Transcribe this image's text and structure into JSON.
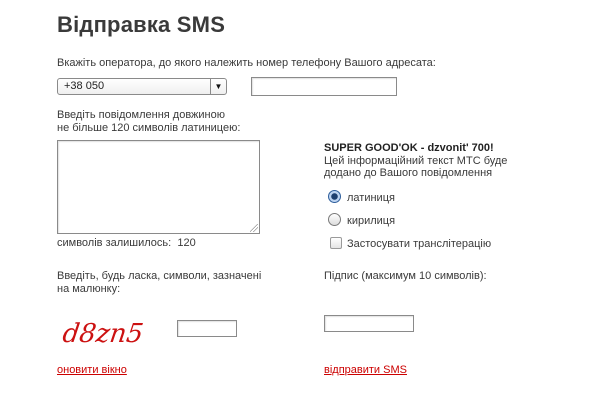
{
  "page_title": "Відправка SMS",
  "operator": {
    "label": "Вкажіть оператора, до якого належить номер телефону Вашого адресата:",
    "selected": "+38 050",
    "arrow": "▼",
    "phone_value": ""
  },
  "message": {
    "label_line1": "Введіть повідомлення довжиною",
    "label_line2": "не більше 120  символів латиницею:",
    "value": "",
    "remaining_label": "символів залишилось:",
    "remaining_count": "120"
  },
  "promo": {
    "title": "SUPER GOOD'OK - dzvonit' 700!",
    "line1": "Цей інформаційний текст МТС буде",
    "line2": "додано до Вашого повідомлення"
  },
  "encoding": {
    "options": [
      {
        "label": "латиниця",
        "selected": true
      },
      {
        "label": "кирилиця",
        "selected": false
      }
    ],
    "transliteration_label": "Застосувати транслітерацію",
    "transliteration_checked": false
  },
  "captcha": {
    "label_line1": "Введіть, будь ласка, символи, зазначені",
    "label_line2": "на малюнку:",
    "image_text": "d8zn5",
    "value": "",
    "refresh_link": "оновити вікно"
  },
  "signature": {
    "label": "Підпис (максимум 10 символів):",
    "value": ""
  },
  "send_link": "відправити SMS",
  "colors": {
    "link": "#cc0000",
    "captcha": "#cc1111",
    "radio_selected": "#2f5f9c"
  }
}
